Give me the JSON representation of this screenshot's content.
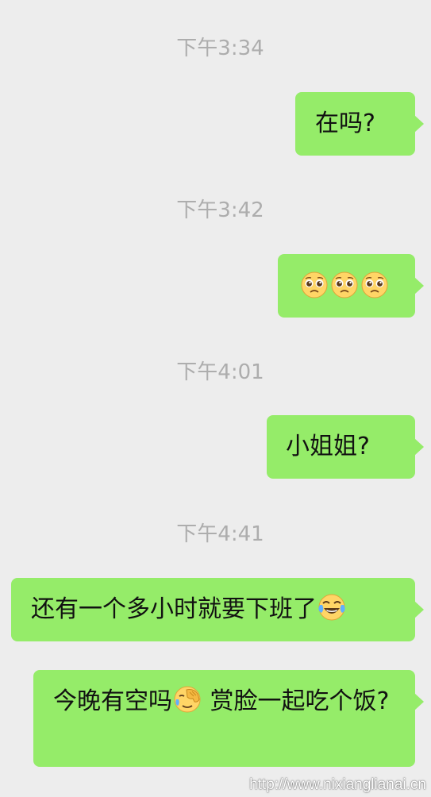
{
  "colors": {
    "background": "#ededed",
    "bubble": "#95ec69",
    "timestamp": "#adadad",
    "text": "#111111"
  },
  "messages": [
    {
      "timestamp": "下午3:34",
      "text": "在吗?"
    },
    {
      "timestamp": "下午3:42",
      "emoji": [
        "pleading-face-icon",
        "pleading-face-icon",
        "pleading-face-icon"
      ]
    },
    {
      "timestamp": "下午4:01",
      "text": "小姐姐?"
    },
    {
      "timestamp": "下午4:41",
      "text": "还有一个多小时就要下班了",
      "trailing_emoji": "tears-of-joy-icon"
    },
    {
      "text_before": "今晚有空吗",
      "inline_emoji": "facepalm-icon",
      "text_after": " 赏脸一起吃个饭?"
    }
  ],
  "watermark": "http://www.nixianglianai.cn"
}
